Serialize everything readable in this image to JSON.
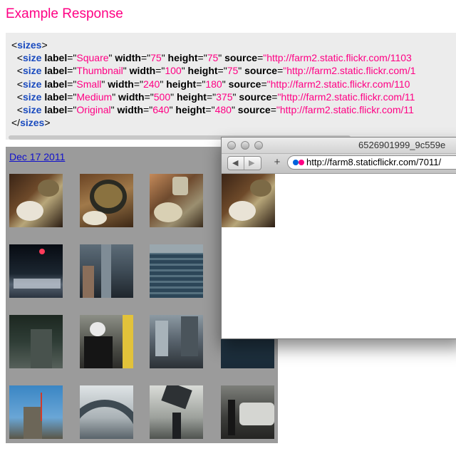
{
  "heading": "Example Response",
  "code": {
    "open_tag": "sizes",
    "close_tag": "sizes",
    "lines": [
      {
        "tag": "size",
        "label_attr": "label",
        "label": "Square",
        "width_attr": "width",
        "width": "75",
        "height_attr": "height",
        "height": "75",
        "source_attr": "source",
        "source": "\"http://farm2.static.flickr.com/1103"
      },
      {
        "tag": "size",
        "label_attr": "label",
        "label": "Thumbnail",
        "width_attr": "width",
        "width": "100",
        "height_attr": "height",
        "height": "75",
        "source_attr": "source",
        "source": "\"http://farm2.static.flickr.com/1"
      },
      {
        "tag": "size",
        "label_attr": "label",
        "label": "Small",
        "width_attr": "width",
        "width": "240",
        "height_attr": "height",
        "height": "180",
        "source_attr": "source",
        "source": "\"http://farm2.static.flickr.com/110"
      },
      {
        "tag": "size",
        "label_attr": "label",
        "label": "Medium",
        "width_attr": "width",
        "width": "500",
        "height_attr": "height",
        "height": "375",
        "source_attr": "source",
        "source": "\"http://farm2.static.flickr.com/11"
      },
      {
        "tag": "size",
        "label_attr": "label",
        "label": "Original",
        "width_attr": "width",
        "width": "640",
        "height_attr": "height",
        "height": "480",
        "source_attr": "source",
        "source": "\"http://farm2.static.flickr.com/11"
      }
    ]
  },
  "gallery": {
    "date_link": "Dec 17 2011",
    "background": "#9b9b9b"
  },
  "browser": {
    "title": "6526901999_9c559e",
    "url": "http://farm8.staticflickr.com/7011/",
    "back_icon": "back-arrow-icon",
    "forward_icon": "forward-arrow-icon",
    "add_icon": "plus-icon"
  },
  "colors": {
    "accent": "#ff0084",
    "tag": "#1a4bbf",
    "link": "#1111cc"
  }
}
